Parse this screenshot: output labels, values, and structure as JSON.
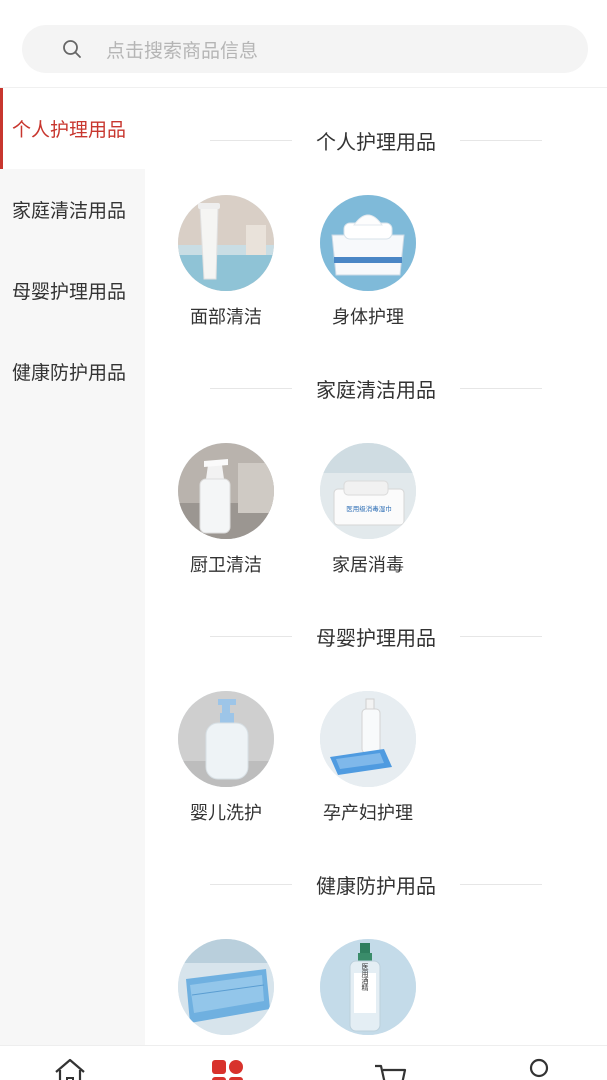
{
  "search": {
    "placeholder": "点击搜索商品信息",
    "icon": "search-icon"
  },
  "sidebar": {
    "items": [
      {
        "label": "个人护理用品",
        "active": true
      },
      {
        "label": "家庭清洁用品",
        "active": false
      },
      {
        "label": "母婴护理用品",
        "active": false
      },
      {
        "label": "健康防护用品",
        "active": false
      }
    ]
  },
  "sections": [
    {
      "title": "个人护理用品",
      "products": [
        {
          "label": "面部清洁"
        },
        {
          "label": "身体护理"
        }
      ]
    },
    {
      "title": "家庭清洁用品",
      "products": [
        {
          "label": "厨卫清洁"
        },
        {
          "label": "家居消毒"
        }
      ]
    },
    {
      "title": "母婴护理用品",
      "products": [
        {
          "label": "婴儿洗护"
        },
        {
          "label": "孕产妇护理"
        }
      ]
    },
    {
      "title": "健康防护用品",
      "products": [
        {
          "label": ""
        },
        {
          "label": ""
        }
      ]
    }
  ],
  "product_image_text": {
    "disinfect_wipes": "医用级消毒湿巾",
    "alcohol_bottle": "医用酒精"
  },
  "tabbar": {
    "tabs": [
      {
        "icon": "home-icon",
        "active": false
      },
      {
        "icon": "category-icon",
        "active": true
      },
      {
        "icon": "cart-icon",
        "active": false
      },
      {
        "icon": "user-icon",
        "active": false
      }
    ]
  },
  "colors": {
    "accent": "#c8362e",
    "sidebar_bg": "#f7f7f7",
    "search_bg": "#f4f4f4"
  }
}
